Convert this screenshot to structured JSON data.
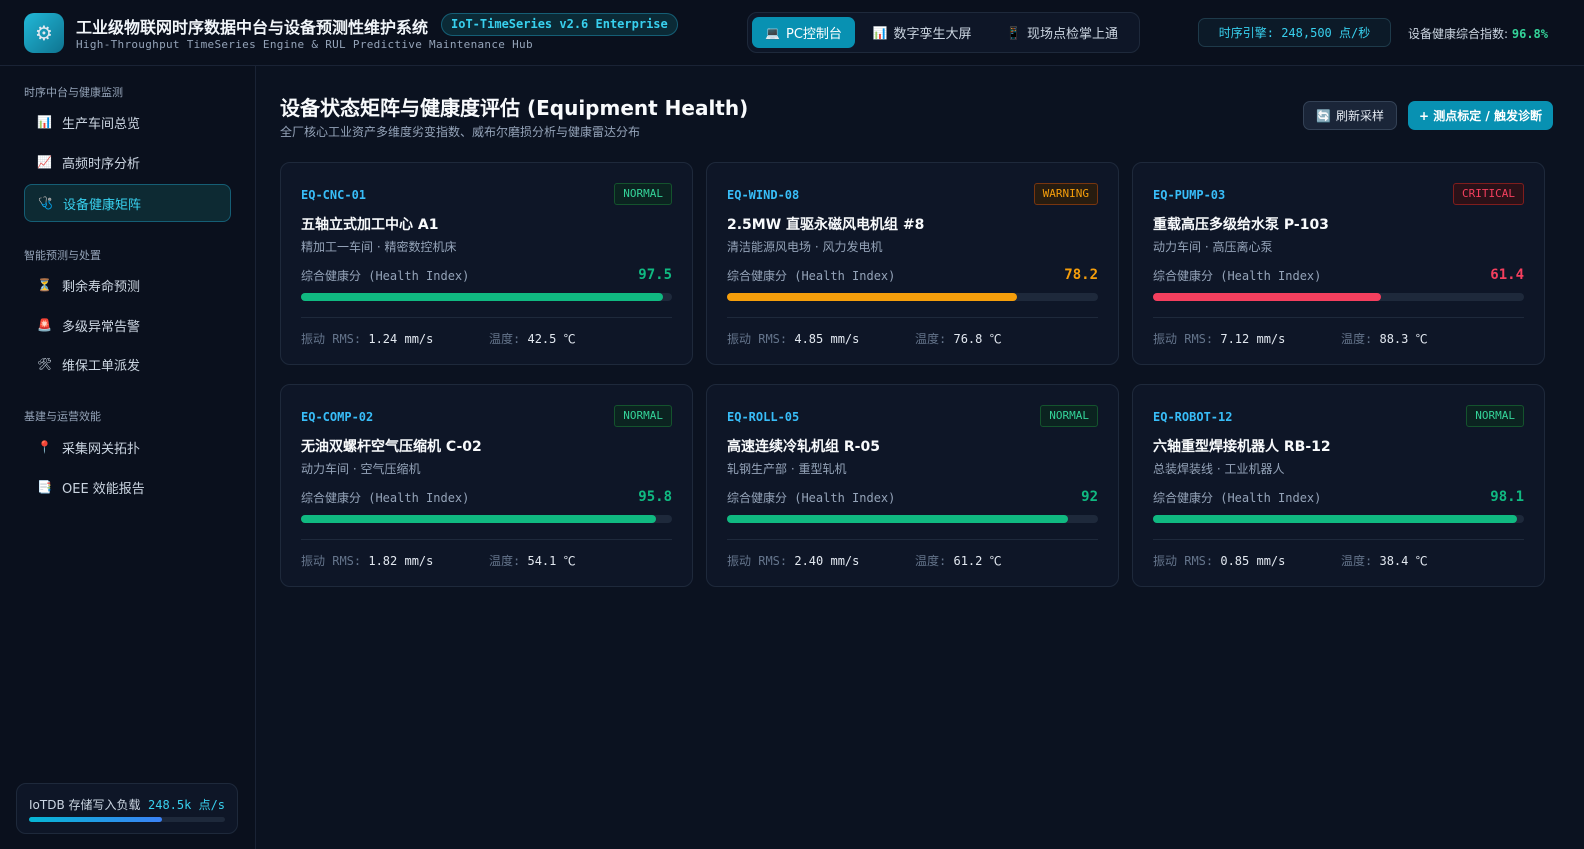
{
  "header": {
    "logo_icon": "gear-icon",
    "title": "工业级物联网时序数据中台与设备预测性维护系统",
    "version": "IoT-TimeSeries v2.6 Enterprise",
    "subtitle": "High-Throughput TimeSeries Engine & RUL Predictive Maintenance Hub",
    "views": [
      {
        "icon": "💻",
        "label": "PC控制台",
        "active": true
      },
      {
        "icon": "📊",
        "label": "数字孪生大屏",
        "active": false
      },
      {
        "icon": "📱",
        "label": "现场点检掌上通",
        "active": false
      }
    ],
    "engine_rate": "时序引擎: 248,500 点/秒",
    "health_index_label": "设备健康综合指数:",
    "health_index_value": "96.8%"
  },
  "sidebar": {
    "groups": [
      {
        "title": "时序中台与健康监测",
        "items": [
          {
            "icon": "📊",
            "label": "生产车间总览",
            "active": false
          },
          {
            "icon": "📈",
            "label": "高频时序分析",
            "active": false
          },
          {
            "icon": "🩺",
            "label": "设备健康矩阵",
            "active": true
          }
        ]
      },
      {
        "title": "智能预测与处置",
        "items": [
          {
            "icon": "⏳",
            "label": "剩余寿命预测",
            "active": false
          },
          {
            "icon": "🚨",
            "label": "多级异常告警",
            "active": false
          },
          {
            "icon": "🛠",
            "label": "维保工单派发",
            "active": false
          }
        ]
      },
      {
        "title": "基建与运营效能",
        "items": [
          {
            "icon": "📍",
            "label": "采集网关拓扑",
            "active": false
          },
          {
            "icon": "📑",
            "label": "OEE 效能报告",
            "active": false
          }
        ]
      }
    ],
    "storage": {
      "label": "IoTDB 存储写入负载",
      "value": "248.5k 点/s",
      "fraction": 0.68
    }
  },
  "main": {
    "title": "设备状态矩阵与健康度评估 (Equipment Health)",
    "subtitle": "全厂核心工业资产多维度劣变指数、威布尔磨损分析与健康雷达分布",
    "refresh_icon": "🔄",
    "refresh_label": "刷新采样",
    "primary_label": "+ 测点标定 / 触发诊断",
    "metric_labels": {
      "health": "综合健康分 (Health Index)",
      "vibration": "振动 RMS:",
      "temperature": "温度:"
    },
    "colors": {
      "normal": "#10b981",
      "warning": "#f59e0b",
      "critical": "#f43f5e"
    },
    "equipment": [
      {
        "id": "EQ-CNC-01",
        "status": "NORMAL",
        "level": "normal",
        "name": "五轴立式加工中心 A1",
        "location": "精加工一车间 · 精密数控机床",
        "health": 97.5,
        "vibration": "1.24 mm/s",
        "temperature": "42.5 ℃"
      },
      {
        "id": "EQ-WIND-08",
        "status": "WARNING",
        "level": "warning",
        "name": "2.5MW 直驱永磁风电机组 #8",
        "location": "清洁能源风电场 · 风力发电机",
        "health": 78.2,
        "vibration": "4.85 mm/s",
        "temperature": "76.8 ℃"
      },
      {
        "id": "EQ-PUMP-03",
        "status": "CRITICAL",
        "level": "critical",
        "name": "重载高压多级给水泵 P-103",
        "location": "动力车间 · 高压离心泵",
        "health": 61.4,
        "vibration": "7.12 mm/s",
        "temperature": "88.3 ℃"
      },
      {
        "id": "EQ-COMP-02",
        "status": "NORMAL",
        "level": "normal",
        "name": "无油双螺杆空气压缩机 C-02",
        "location": "动力车间 · 空气压缩机",
        "health": 95.8,
        "vibration": "1.82 mm/s",
        "temperature": "54.1 ℃"
      },
      {
        "id": "EQ-ROLL-05",
        "status": "NORMAL",
        "level": "normal",
        "name": "高速连续冷轧机组 R-05",
        "location": "轧钢生产部 · 重型轧机",
        "health": 92,
        "vibration": "2.40 mm/s",
        "temperature": "61.2 ℃"
      },
      {
        "id": "EQ-ROBOT-12",
        "status": "NORMAL",
        "level": "normal",
        "name": "六轴重型焊接机器人 RB-12",
        "location": "总装焊装线 · 工业机器人",
        "health": 98.1,
        "vibration": "0.85 mm/s",
        "temperature": "38.4 ℃"
      }
    ]
  }
}
